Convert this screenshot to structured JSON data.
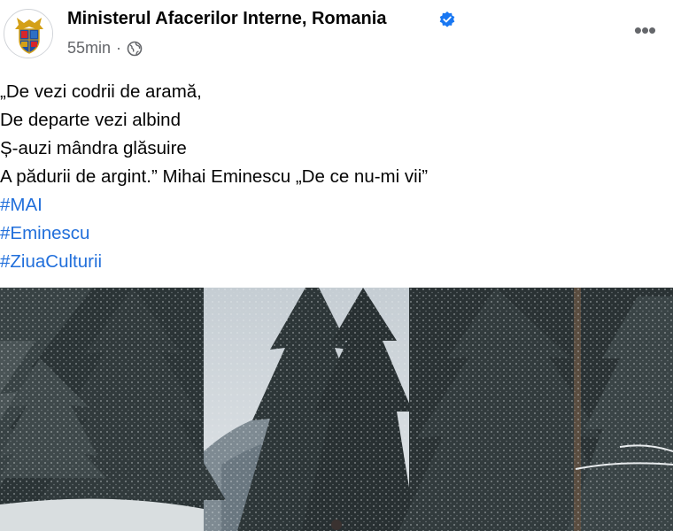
{
  "post": {
    "author": "Ministerul Afacerilor Interne, Romania",
    "time": "55min",
    "separator": "·",
    "privacy_icon": "globe-icon",
    "verified_icon": "verified-badge-icon",
    "more_icon": "more-options-icon",
    "more_label": "•••",
    "lines": [
      "„De vezi codrii de aramă,",
      "De departe vezi albind",
      "Ș-auzi mândra glăsuire",
      "A pădurii de argint.” Mihai Eminescu  „De ce nu-mi vii”"
    ],
    "hashtags": [
      "#MAI",
      "#Eminescu",
      "#ZiuaCulturii"
    ]
  },
  "colors": {
    "hashtag": "#216fdb",
    "verified": "#1877f2",
    "muted": "#65676b",
    "text": "#050505"
  }
}
